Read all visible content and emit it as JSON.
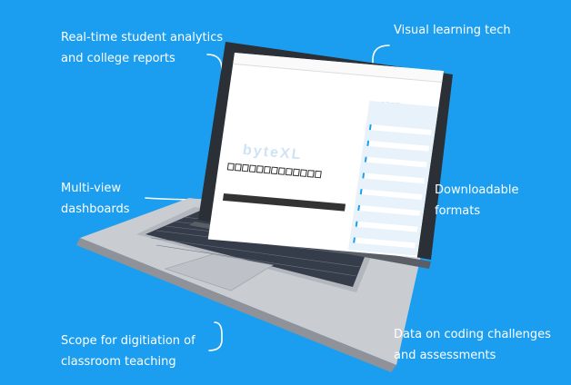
{
  "callouts": {
    "analytics_line1": "Real-time student analytics",
    "analytics_line2": "and college reports",
    "dashboards_line1": "Multi-view",
    "dashboards_line2": "dashboards",
    "digitisation_line1": "Scope for digitiation of",
    "digitisation_line2": "classroom teaching",
    "visual_tech": "Visual learning tech",
    "downloadable_line1": "Downloadable",
    "downloadable_line2": "formats",
    "coding_line1": "Data on coding challenges",
    "coding_line2": "and assessments"
  },
  "screen": {
    "watermark": "byteXL"
  },
  "colors": {
    "background": "#1b9ef0",
    "text": "#ffffff",
    "laptop_body": "#c9ccd1",
    "keys": "#2a3140"
  }
}
